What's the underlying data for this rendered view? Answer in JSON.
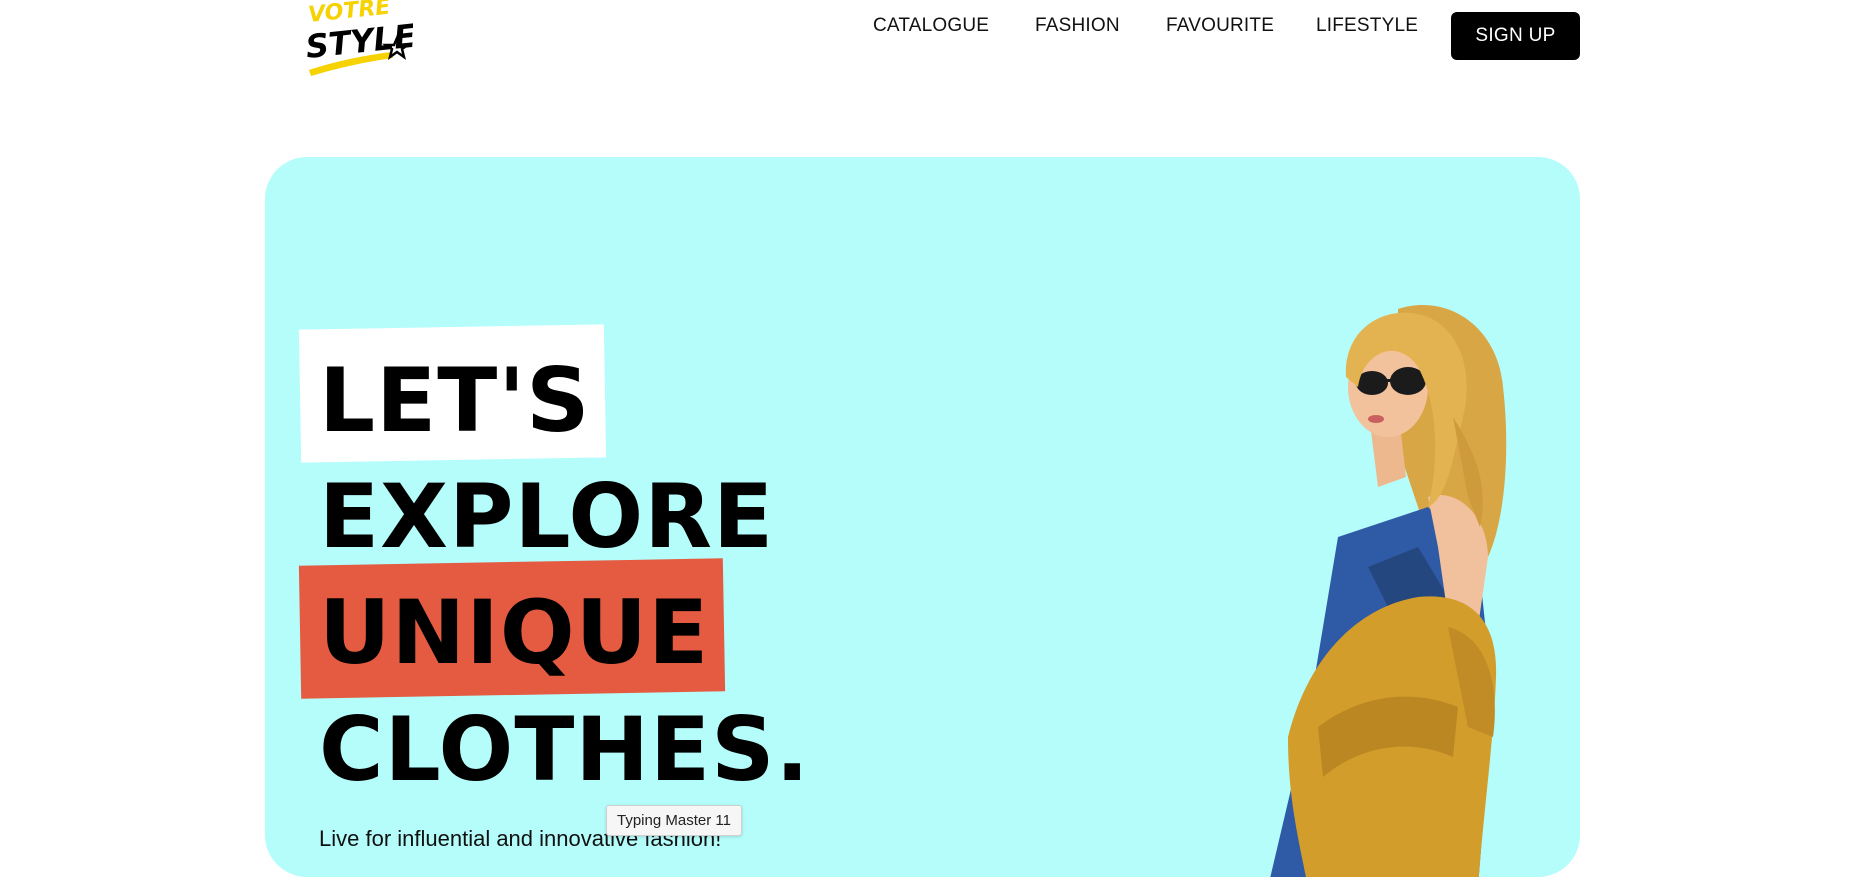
{
  "header": {
    "logo": {
      "line1": "VOTRE",
      "line2": "STYLE"
    },
    "nav": [
      {
        "label": "CATALOGUE"
      },
      {
        "label": "FASHION"
      },
      {
        "label": "FAVOURITE"
      },
      {
        "label": "LIFESTYLE"
      }
    ],
    "signup_label": "SIGN UP"
  },
  "hero": {
    "headline": [
      "LET'S",
      "EXPLORE",
      "UNIQUE",
      "CLOTHES."
    ],
    "subtext": "Live for influential and innovative fashion!",
    "colors": {
      "background": "#b4fdfb",
      "highlight_white": "#ffffff",
      "highlight_red": "#e45b41"
    }
  },
  "tooltip": {
    "text": "Typing Master 11"
  },
  "colors": {
    "brand_yellow": "#f5d200",
    "button": "#000000"
  }
}
